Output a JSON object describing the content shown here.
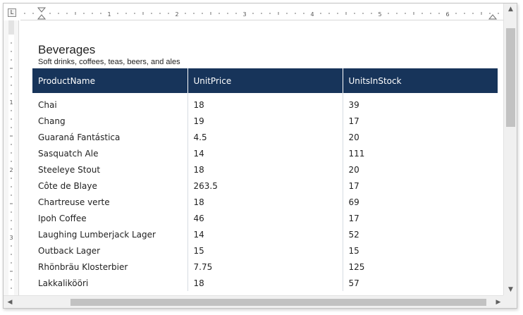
{
  "ruler": {
    "corner_label": "L",
    "marks": [
      "1",
      "2",
      "3",
      "4",
      "5",
      "6"
    ],
    "vertical_marks": [
      "1",
      "2",
      "3"
    ]
  },
  "document": {
    "title": "Beverages",
    "subtitle": "Soft drinks, coffees, teas, beers, and ales"
  },
  "table": {
    "columns": [
      "ProductName",
      "UnitPrice",
      "UnitsInStock"
    ],
    "rows": [
      [
        "Chai",
        "18",
        "39"
      ],
      [
        "Chang",
        "19",
        "17"
      ],
      [
        "Guaraná Fantástica",
        "4.5",
        "20"
      ],
      [
        "Sasquatch Ale",
        "14",
        "111"
      ],
      [
        "Steeleye Stout",
        "18",
        "20"
      ],
      [
        "Côte de Blaye",
        "263.5",
        "17"
      ],
      [
        "Chartreuse verte",
        "18",
        "69"
      ],
      [
        "Ipoh Coffee",
        "46",
        "17"
      ],
      [
        "Laughing Lumberjack Lager",
        "14",
        "52"
      ],
      [
        "Outback Lager",
        "15",
        "15"
      ],
      [
        "Rhönbräu Klosterbier",
        "7.75",
        "125"
      ],
      [
        "Lakkalikööri",
        "18",
        "57"
      ]
    ]
  },
  "scrollbars": {
    "up_arrow": "▲",
    "down_arrow": "▼",
    "left_arrow": "◀",
    "right_arrow": "▶"
  },
  "colors": {
    "header_bg": "#17345a",
    "header_text": "#ffffff"
  }
}
